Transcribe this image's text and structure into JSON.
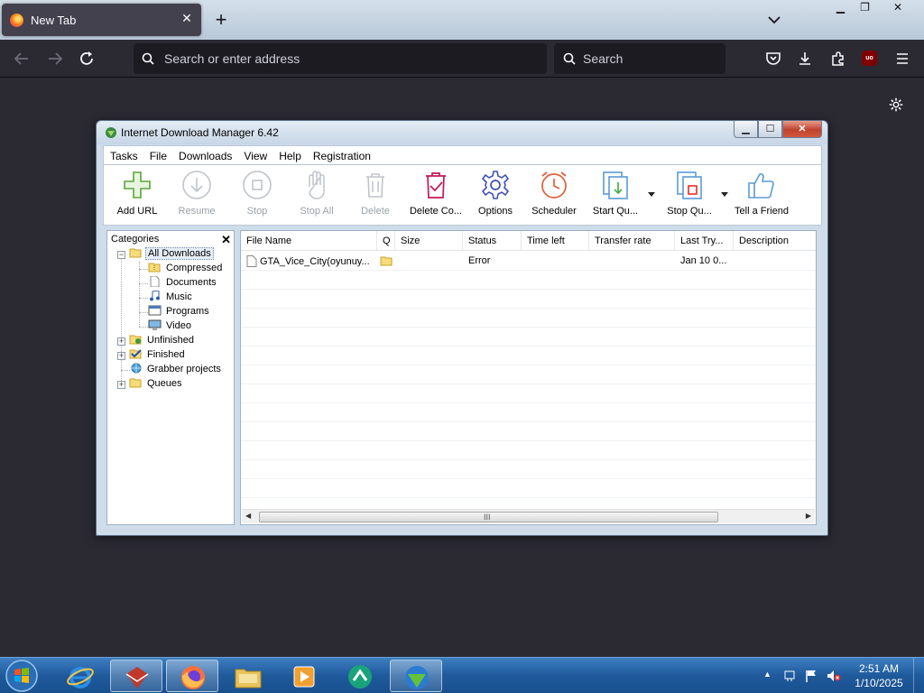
{
  "browser": {
    "tab_title": "New Tab",
    "url_placeholder": "Search or enter address",
    "search_placeholder": "Search",
    "ublock_label": "uo"
  },
  "idm": {
    "title": "Internet Download Manager 6.42",
    "menu": [
      "Tasks",
      "File",
      "Downloads",
      "View",
      "Help",
      "Registration"
    ],
    "toolbar": [
      {
        "label": "Add URL",
        "icon": "add-url-icon",
        "enabled": true
      },
      {
        "label": "Resume",
        "icon": "resume-icon",
        "enabled": false
      },
      {
        "label": "Stop",
        "icon": "stop-icon",
        "enabled": false
      },
      {
        "label": "Stop All",
        "icon": "stop-all-icon",
        "enabled": false
      },
      {
        "label": "Delete",
        "icon": "delete-icon",
        "enabled": false
      },
      {
        "label": "Delete Co...",
        "icon": "delete-completed-icon",
        "enabled": true
      },
      {
        "label": "Options",
        "icon": "options-gear-icon",
        "enabled": true
      },
      {
        "label": "Scheduler",
        "icon": "scheduler-clock-icon",
        "enabled": true
      },
      {
        "label": "Start Qu...",
        "icon": "start-queue-icon",
        "enabled": true
      },
      {
        "label": "Stop Qu...",
        "icon": "stop-queue-icon",
        "enabled": true
      },
      {
        "label": "Tell a Friend",
        "icon": "thumbs-up-icon",
        "enabled": true
      }
    ],
    "categories": {
      "title": "Categories",
      "items": [
        {
          "label": "All Downloads",
          "icon": "open-folder-icon"
        },
        {
          "label": "Compressed",
          "icon": "compressed-folder-icon"
        },
        {
          "label": "Documents",
          "icon": "document-icon"
        },
        {
          "label": "Music",
          "icon": "music-note-icon"
        },
        {
          "label": "Programs",
          "icon": "program-window-icon"
        },
        {
          "label": "Video",
          "icon": "video-monitor-icon"
        },
        {
          "label": "Unfinished",
          "icon": "unfinished-folder-icon"
        },
        {
          "label": "Finished",
          "icon": "finished-checkmark-icon"
        },
        {
          "label": "Grabber projects",
          "icon": "grabber-globe-icon"
        },
        {
          "label": "Queues",
          "icon": "queue-folder-icon"
        }
      ]
    },
    "columns": [
      "File Name",
      "Q",
      "Size",
      "Status",
      "Time left",
      "Transfer rate",
      "Last Try...",
      "Description"
    ],
    "rows": [
      {
        "file_name": "GTA_Vice_City(oyunuy...",
        "queue": "",
        "size": "",
        "status": "Error",
        "time_left": "",
        "transfer_rate": "",
        "last_try": "Jan 10 0...",
        "description": ""
      }
    ]
  },
  "taskbar": {
    "apps": [
      "windows-start-icon",
      "internet-explorer-icon",
      "winrar-icon",
      "firefox-icon",
      "file-explorer-icon",
      "media-player-icon",
      "messenger-icon",
      "idm-icon"
    ],
    "time": "2:51 AM",
    "date": "1/10/2025"
  }
}
